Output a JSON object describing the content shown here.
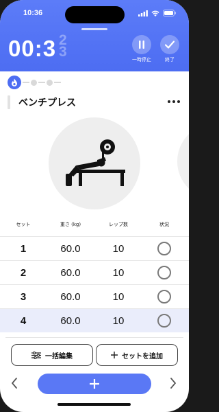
{
  "status_bar": {
    "time": "10:36"
  },
  "header": {
    "timer": "00:3",
    "timer_rolling_digits": "2\n3",
    "pause_label": "一時停止",
    "finish_label": "終了"
  },
  "exercise": {
    "title": "ベンチプレス"
  },
  "table": {
    "headers": {
      "set": "セット",
      "weight": "重さ (kg)",
      "reps": "レップ数",
      "status": "状況"
    },
    "rows": [
      {
        "set": "1",
        "weight": "60.0",
        "reps": "10",
        "done": false
      },
      {
        "set": "2",
        "weight": "60.0",
        "reps": "10",
        "done": false
      },
      {
        "set": "3",
        "weight": "60.0",
        "reps": "10",
        "done": false
      },
      {
        "set": "4",
        "weight": "60.0",
        "reps": "10",
        "done": false
      }
    ]
  },
  "buttons": {
    "bulk_edit": "一括編集",
    "add_set": "セットを追加"
  },
  "colors": {
    "accent": "#4d6df2",
    "highlight_row": "#eaedfb"
  },
  "icons": [
    "flame-icon",
    "pause-icon",
    "check-icon",
    "more-icon",
    "sliders-icon",
    "plus-icon",
    "chevron-left-icon",
    "chevron-right-icon",
    "bench-press-icon"
  ]
}
